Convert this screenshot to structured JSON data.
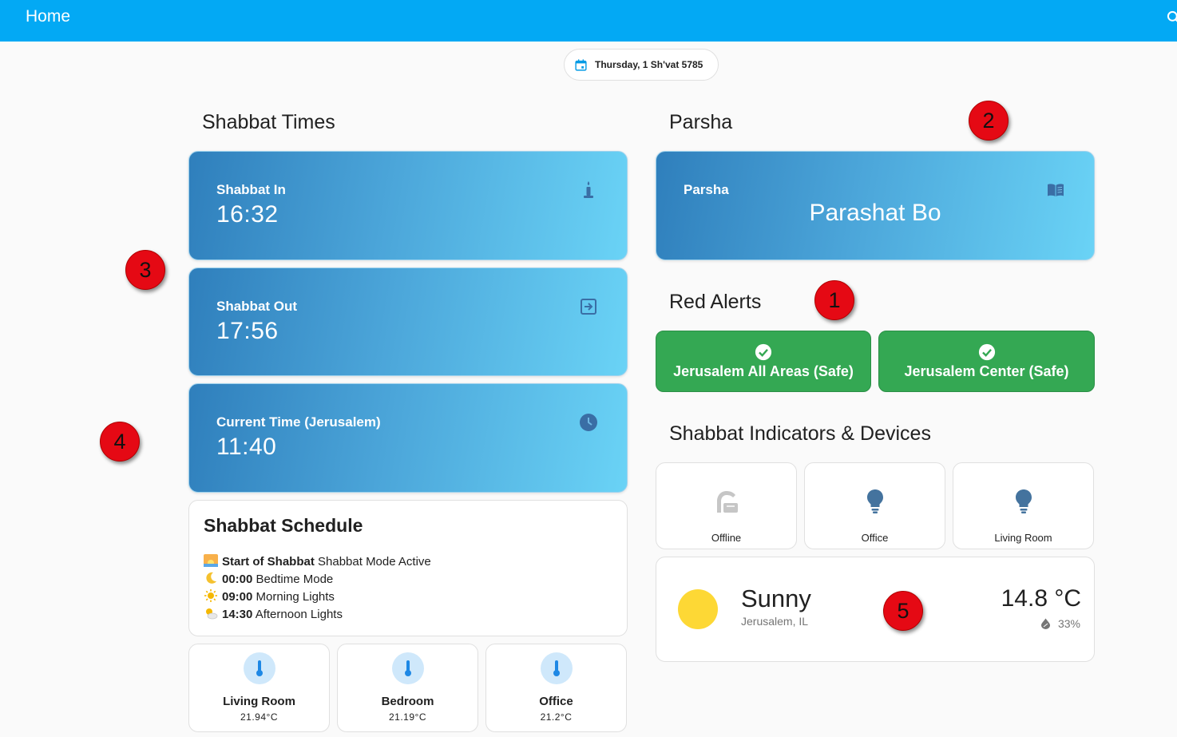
{
  "header": {
    "title": "Home",
    "search_icon": "search-icon"
  },
  "date_chip": {
    "text": "Thursday, 1 Sh'vat 5785",
    "icon": "calendar-icon"
  },
  "shabbat_times": {
    "title": "Shabbat Times",
    "cards": [
      {
        "label": "Shabbat In",
        "value": "16:32",
        "icon": "candle-icon"
      },
      {
        "label": "Shabbat Out",
        "value": "17:56",
        "icon": "exit-icon"
      },
      {
        "label": "Current Time (Jerusalem)",
        "value": "11:40",
        "icon": "clock-icon"
      }
    ]
  },
  "schedule": {
    "title": "Shabbat Schedule",
    "items": [
      {
        "icon": "sunrise-icon",
        "time": "Start of Shabbat",
        "text": "Shabbat Mode Active"
      },
      {
        "icon": "moon-icon",
        "time": "00:00",
        "text": "Bedtime Mode"
      },
      {
        "icon": "sun-icon",
        "time": "09:00",
        "text": "Morning Lights"
      },
      {
        "icon": "sun-cloud-icon",
        "time": "14:30",
        "text": "Afternoon Lights"
      }
    ]
  },
  "temperatures": [
    {
      "name": "Living Room",
      "value": "21.94°C",
      "icon": "thermometer-icon"
    },
    {
      "name": "Bedroom",
      "value": "21.19°C",
      "icon": "thermometer-icon"
    },
    {
      "name": "Office",
      "value": "21.2°C",
      "icon": "thermometer-icon"
    }
  ],
  "parsha": {
    "title": "Parsha",
    "label": "Parsha",
    "value": "Parashat Bo",
    "icon": "book-icon"
  },
  "red_alerts": {
    "title": "Red Alerts",
    "items": [
      {
        "label": "Jerusalem All Areas (Safe)",
        "icon": "check-circle-icon"
      },
      {
        "label": "Jerusalem Center (Safe)",
        "icon": "check-circle-icon"
      }
    ]
  },
  "devices": {
    "title": "Shabbat Indicators & Devices",
    "items": [
      {
        "label": "Offline",
        "icon": "hot-plate-icon"
      },
      {
        "label": "Office",
        "icon": "lightbulb-icon"
      },
      {
        "label": "Living Room",
        "icon": "lightbulb-icon"
      }
    ]
  },
  "weather": {
    "condition": "Sunny",
    "location": "Jerusalem, IL",
    "temperature": "14.8 °C",
    "humidity": "33%",
    "icon": "sun-icon"
  },
  "markers": [
    "1",
    "2",
    "3",
    "4",
    "5"
  ],
  "colors": {
    "header": "#03a9f4",
    "alert_safe": "#34a853",
    "card_gradient_start": "#2f7fbc",
    "card_gradient_end": "#6ad3f6",
    "marker": "#e50914"
  }
}
